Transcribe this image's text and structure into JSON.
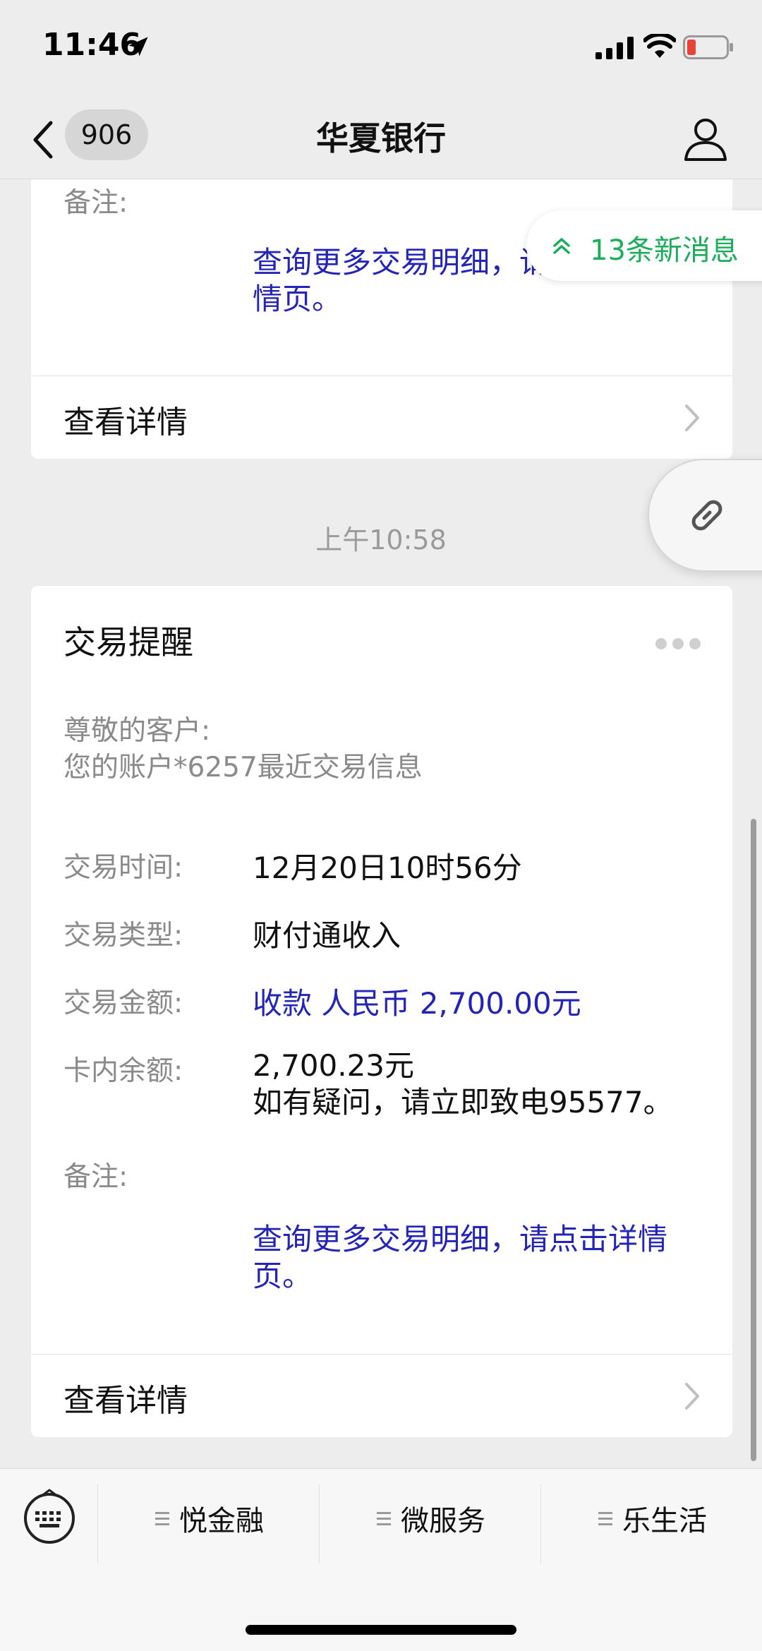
{
  "status_bar": {
    "time": "11:46"
  },
  "nav": {
    "back_count": "906",
    "title": "华夏银行"
  },
  "new_messages": {
    "label": "13条新消息"
  },
  "card_previous": {
    "note_label": "备注:",
    "note_link": "查询更多交易明细，请点击详情页。",
    "detail_label": "查看详情"
  },
  "timestamp": "上午10:58",
  "card_transaction": {
    "title": "交易提醒",
    "greeting_line1": "尊敬的客户:",
    "greeting_line2": "您的账户*6257最近交易信息",
    "rows": [
      {
        "label": "交易时间:",
        "value": "12月20日10时56分"
      },
      {
        "label": "交易类型:",
        "value": "财付通收入"
      },
      {
        "label": "交易金额:",
        "value": "收款 人民币 2,700.00元"
      },
      {
        "label": "卡内余额:",
        "value": "2,700.23元"
      }
    ],
    "balance_note": "如有疑问，请立即致电95577。",
    "note_label": "备注:",
    "note_link": "查询更多交易明细，请点击详情页。",
    "detail_label": "查看详情"
  },
  "bottom_menu": {
    "items": [
      {
        "label": "悦金融"
      },
      {
        "label": "微服务"
      },
      {
        "label": "乐生活"
      }
    ]
  },
  "colors": {
    "link_blue": "#2424b8",
    "new_message_green": "#1aad5a",
    "battery_low_red": "#e8423a"
  }
}
